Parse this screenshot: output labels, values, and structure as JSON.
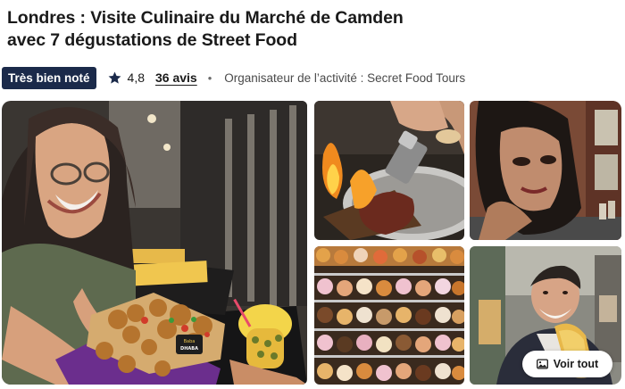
{
  "header": {
    "title_line1": "Londres : Visite Culinaire du Marché de Camden",
    "title_line2": "avec 7 dégustations de Street Food"
  },
  "meta": {
    "badge": "Très bien noté",
    "rating": "4,8",
    "reviews": "36 avis",
    "separator": "•",
    "organizer": "Organisateur de l’activité : Secret Food Tours"
  },
  "gallery": {
    "photos": [
      {
        "subject": "woman-laughing-holding-street-food-tray"
      },
      {
        "subject": "chef-torching-meat-with-flame"
      },
      {
        "subject": "amy-winehouse-mural"
      },
      {
        "subject": "donut-bakery-display"
      },
      {
        "subject": "smiling-guide-with-food"
      }
    ],
    "tray_sign": "Baba DHABA",
    "view_all_label": "Voir tout"
  },
  "colors": {
    "badge_bg": "#1b2a4a",
    "text": "#1a1a1a",
    "muted": "#4a4a4a"
  },
  "icons": {
    "star": "star-icon",
    "view_all": "image-icon"
  }
}
